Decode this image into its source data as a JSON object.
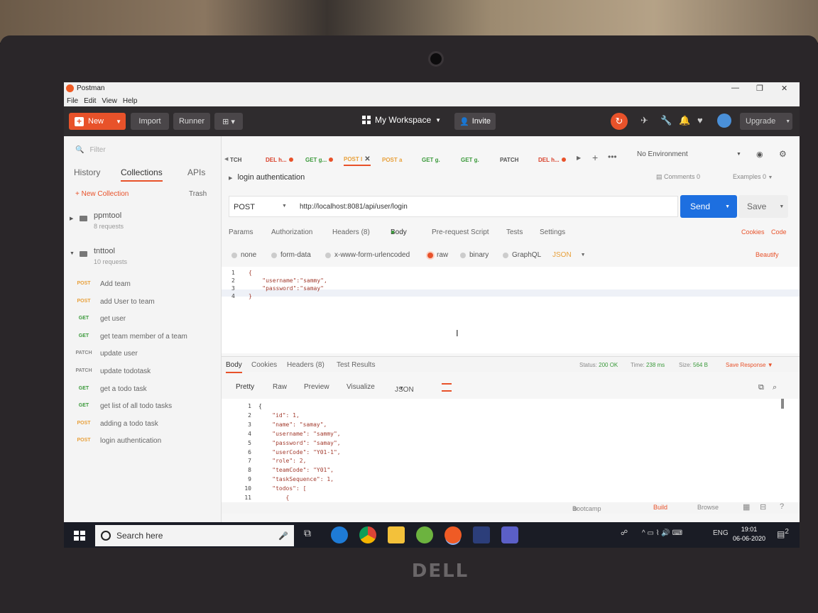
{
  "app": {
    "title": "Postman",
    "menu": [
      "File",
      "Edit",
      "View",
      "Help"
    ],
    "window_controls": [
      "—",
      "❐",
      "✕"
    ]
  },
  "toolbar": {
    "new_label": "New",
    "import_label": "Import",
    "runner_label": "Runner",
    "workspace_label": "My Workspace",
    "invite_label": "Invite",
    "upgrade_label": "Upgrade"
  },
  "sidebar": {
    "filter_placeholder": "Filter",
    "tabs": [
      "History",
      "Collections",
      "APIs"
    ],
    "new_collection": "+ New Collection",
    "trash": "Trash",
    "collections": [
      {
        "name": "ppmtool",
        "count": "8 requests"
      },
      {
        "name": "tnttool",
        "count": "10 requests"
      }
    ],
    "requests": [
      {
        "method": "POST",
        "name": "Add team"
      },
      {
        "method": "POST",
        "name": "add User to team"
      },
      {
        "method": "GET",
        "name": "get user"
      },
      {
        "method": "GET",
        "name": "get team member of a team"
      },
      {
        "method": "PATCH",
        "name": "update user"
      },
      {
        "method": "PATCH",
        "name": "update todotask"
      },
      {
        "method": "GET",
        "name": "get a todo task"
      },
      {
        "method": "GET",
        "name": "get list of all todo tasks"
      },
      {
        "method": "POST",
        "name": "adding a todo task"
      },
      {
        "method": "POST",
        "name": "login authentication"
      }
    ]
  },
  "request_tabs": [
    {
      "label": "TCH"
    },
    {
      "label": "DEL h..."
    },
    {
      "label": "GET g..."
    },
    {
      "label": "POST l"
    },
    {
      "label": "POST a"
    },
    {
      "label": "GET g."
    },
    {
      "label": "GET g."
    },
    {
      "label": "PATCH"
    },
    {
      "label": "DEL h..."
    }
  ],
  "environment": "No Environment",
  "request": {
    "name": "login authentication",
    "comments": "Comments 0",
    "examples": "Examples 0",
    "method": "POST",
    "url": "http://localhost:8081/api/user/login",
    "send_label": "Send",
    "save_label": "Save",
    "tabs": [
      "Params",
      "Authorization",
      "Headers (8)",
      "Body",
      "Pre-request Script",
      "Tests",
      "Settings"
    ],
    "cookies_label": "Cookies",
    "code_label": "Code",
    "body_types": [
      "none",
      "form-data",
      "x-www-form-urlencoded",
      "raw",
      "binary",
      "GraphQL"
    ],
    "body_format": "JSON",
    "beautify_label": "Beautify",
    "body_lines": [
      {
        "n": "1",
        "text": "{"
      },
      {
        "n": "2",
        "text": "    \"username\":\"sammy\","
      },
      {
        "n": "3",
        "text": "    \"password\":\"samay\""
      },
      {
        "n": "4",
        "text": "}"
      }
    ]
  },
  "response": {
    "tabs": [
      "Body",
      "Cookies",
      "Headers (8)",
      "Test Results"
    ],
    "status_label": "Status:",
    "status_value": "200 OK",
    "time_label": "Time:",
    "time_value": "238 ms",
    "size_label": "Size:",
    "size_value": "564 B",
    "save_response": "Save Response",
    "view_modes": [
      "Pretty",
      "Raw",
      "Preview",
      "Visualize"
    ],
    "format": "JSON",
    "lines": [
      {
        "n": "1",
        "text": "{"
      },
      {
        "n": "2",
        "text": "    \"id\": 1,"
      },
      {
        "n": "3",
        "text": "    \"name\": \"samay\","
      },
      {
        "n": "4",
        "text": "    \"username\": \"sammy\","
      },
      {
        "n": "5",
        "text": "    \"password\": \"samay\","
      },
      {
        "n": "6",
        "text": "    \"userCode\": \"Y01-1\","
      },
      {
        "n": "7",
        "text": "    \"role\": 2,"
      },
      {
        "n": "8",
        "text": "    \"teamCode\": \"Y01\","
      },
      {
        "n": "9",
        "text": "    \"taskSequence\": 1,"
      },
      {
        "n": "10",
        "text": "    \"todos\": ["
      },
      {
        "n": "11",
        "text": "        {"
      }
    ]
  },
  "statusbar": {
    "bootcamp": "Bootcamp",
    "build": "Build",
    "browse": "Browse"
  },
  "taskbar": {
    "search_placeholder": "Search here",
    "language": "ENG",
    "time": "19:01",
    "date": "06-06-2020",
    "notification_count": "2"
  },
  "device": {
    "brand": "DELL"
  },
  "colors": {
    "accent": "#e8522a",
    "send_blue": "#1d6fe0",
    "toolbar_dark": "#2f2c2e",
    "success_green": "#3b9a3b"
  }
}
